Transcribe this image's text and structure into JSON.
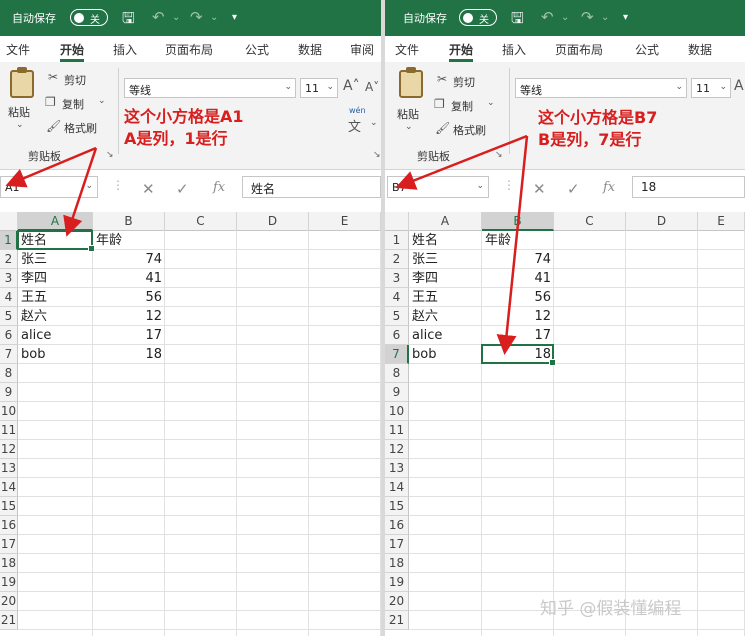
{
  "left": {
    "title": {
      "autosave_label": "自动保存",
      "toggle_text": "关"
    },
    "tabs": [
      "文件",
      "开始",
      "插入",
      "页面布局",
      "公式",
      "数据",
      "审阅"
    ],
    "active_tab": "开始",
    "ribbon": {
      "paste_label": "粘贴",
      "cut_label": "剪切",
      "copy_label": "复制",
      "format_painter_label": "格式刷",
      "clipboard_group_label": "剪贴板",
      "font_name": "等线",
      "font_size": "11",
      "wen_label": "wén"
    },
    "annotation": {
      "line1": "这个小方格是A1",
      "line2": "A是列，1是行"
    },
    "formula_bar": {
      "name_box": "A1",
      "formula_value": "姓名"
    },
    "columns": [
      "A",
      "B",
      "C",
      "D",
      "E"
    ],
    "selected_column": "A",
    "rows": [
      "1",
      "2",
      "3",
      "4",
      "5",
      "6",
      "7",
      "8",
      "9",
      "10",
      "11",
      "12",
      "13",
      "14",
      "15",
      "16",
      "17",
      "18",
      "19",
      "20",
      "21"
    ],
    "selected_row": "1",
    "data": [
      {
        "name": "姓名",
        "age": "年龄"
      },
      {
        "name": "张三",
        "age": "74"
      },
      {
        "name": "李四",
        "age": "41"
      },
      {
        "name": "王五",
        "age": "56"
      },
      {
        "name": "赵六",
        "age": "12"
      },
      {
        "name": "alice",
        "age": "17"
      },
      {
        "name": "bob",
        "age": "18"
      }
    ]
  },
  "right": {
    "title": {
      "autosave_label": "自动保存",
      "toggle_text": "关"
    },
    "tabs": [
      "文件",
      "开始",
      "插入",
      "页面布局",
      "公式",
      "数据"
    ],
    "active_tab": "开始",
    "ribbon": {
      "paste_label": "粘贴",
      "cut_label": "剪切",
      "copy_label": "复制",
      "format_painter_label": "格式刷",
      "clipboard_group_label": "剪贴板",
      "font_name": "等线",
      "font_size": "11"
    },
    "annotation": {
      "line1": "这个小方格是B7",
      "line2": "B是列，7是行"
    },
    "formula_bar": {
      "name_box": "B7",
      "formula_value": "18"
    },
    "columns": [
      "A",
      "B",
      "C",
      "D",
      "E"
    ],
    "selected_column": "B",
    "rows": [
      "1",
      "2",
      "3",
      "4",
      "5",
      "6",
      "7",
      "8",
      "9",
      "10",
      "11",
      "12",
      "13",
      "14",
      "15",
      "16",
      "17",
      "18",
      "19",
      "20",
      "21"
    ],
    "selected_row": "7",
    "data": [
      {
        "name": "姓名",
        "age": "年龄"
      },
      {
        "name": "张三",
        "age": "74"
      },
      {
        "name": "李四",
        "age": "41"
      },
      {
        "name": "王五",
        "age": "56"
      },
      {
        "name": "赵六",
        "age": "12"
      },
      {
        "name": "alice",
        "age": "17"
      },
      {
        "name": "bob",
        "age": "18"
      }
    ]
  },
  "watermark": "知乎 @假装懂编程",
  "colors": {
    "excel_green": "#217346",
    "annotation_red": "#d81e1e"
  }
}
